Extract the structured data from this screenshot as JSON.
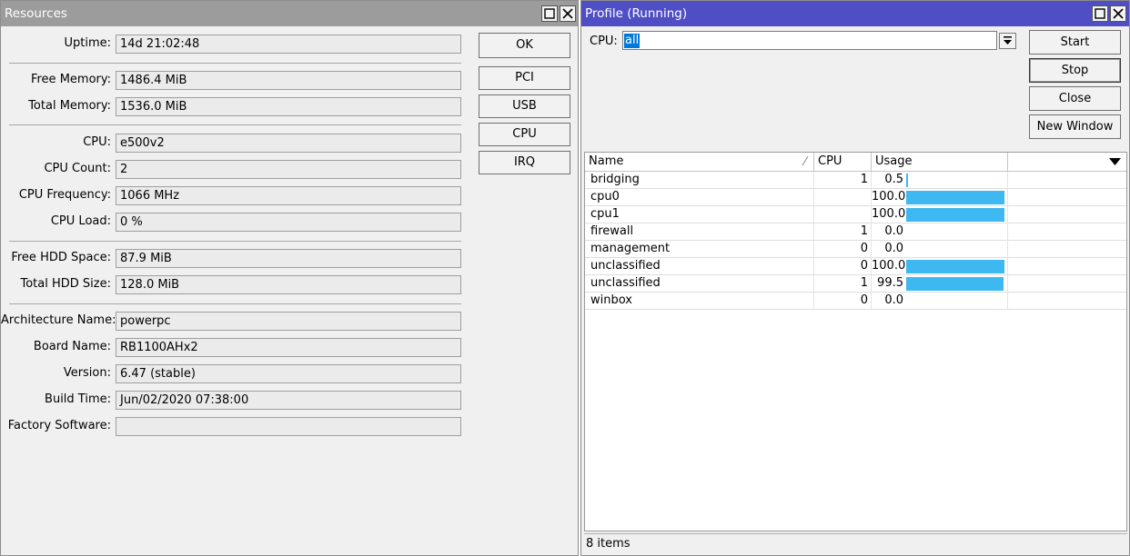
{
  "resources": {
    "title": "Resources",
    "fields": [
      {
        "label": "Uptime:",
        "value": "14d 21:02:48"
      },
      {
        "label": "Free Memory:",
        "value": "1486.4 MiB"
      },
      {
        "label": "Total Memory:",
        "value": "1536.0 MiB"
      },
      {
        "label": "CPU:",
        "value": "e500v2"
      },
      {
        "label": "CPU Count:",
        "value": "2"
      },
      {
        "label": "CPU Frequency:",
        "value": "1066 MHz"
      },
      {
        "label": "CPU Load:",
        "value": "0 %"
      },
      {
        "label": "Free HDD Space:",
        "value": "87.9 MiB"
      },
      {
        "label": "Total HDD Size:",
        "value": "128.0 MiB"
      },
      {
        "label": "Architecture Name:",
        "value": "powerpc"
      },
      {
        "label": "Board Name:",
        "value": "RB1100AHx2"
      },
      {
        "label": "Version:",
        "value": "6.47 (stable)"
      },
      {
        "label": "Build Time:",
        "value": "Jun/02/2020 07:38:00"
      },
      {
        "label": "Factory Software:",
        "value": ""
      }
    ],
    "buttons": {
      "ok": "OK",
      "pci": "PCI",
      "usb": "USB",
      "cpu": "CPU",
      "irq": "IRQ"
    }
  },
  "profile": {
    "title": "Profile (Running)",
    "cpu_label": "CPU:",
    "cpu_value": "all",
    "buttons": {
      "start": "Start",
      "stop": "Stop",
      "close": "Close",
      "new_window": "New Window"
    },
    "columns": {
      "name": "Name",
      "cpu": "CPU",
      "usage": "Usage"
    },
    "rows": [
      {
        "name": "bridging",
        "cpu": "1",
        "usage": "0.5",
        "usage_pct": 0.5
      },
      {
        "name": "cpu0",
        "cpu": "",
        "usage": "100.0",
        "usage_pct": 100.0
      },
      {
        "name": "cpu1",
        "cpu": "",
        "usage": "100.0",
        "usage_pct": 100.0
      },
      {
        "name": "firewall",
        "cpu": "1",
        "usage": "0.0",
        "usage_pct": 0.0
      },
      {
        "name": "management",
        "cpu": "0",
        "usage": "0.0",
        "usage_pct": 0.0
      },
      {
        "name": "unclassified",
        "cpu": "0",
        "usage": "100.0",
        "usage_pct": 100.0
      },
      {
        "name": "unclassified",
        "cpu": "1",
        "usage": "99.5",
        "usage_pct": 99.5
      },
      {
        "name": "winbox",
        "cpu": "0",
        "usage": "0.0",
        "usage_pct": 0.0
      }
    ],
    "status": "8 items"
  },
  "colors": {
    "resources_titlebar": "#9c9c9c",
    "profile_titlebar": "#4f4ec4",
    "usage_bar": "#3db8f0",
    "selection": "#0078d7"
  }
}
